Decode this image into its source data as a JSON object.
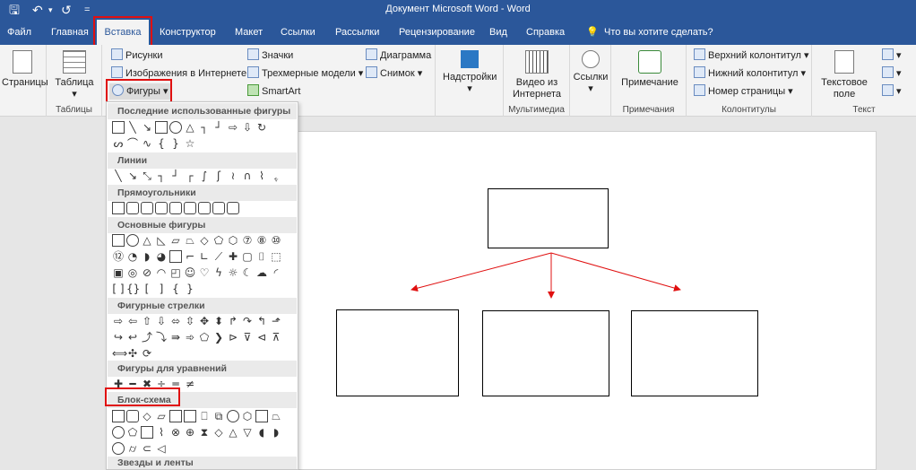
{
  "title": "Документ Microsoft Word  -  Word",
  "qat": {
    "save": "🖫",
    "undo": "↶",
    "redo": "↺",
    "more": "="
  },
  "tabs": [
    "Файл",
    "Главная",
    "Вставка",
    "Конструктор",
    "Макет",
    "Ссылки",
    "Рассылки",
    "Рецензирование",
    "Вид",
    "Справка",
    "Что вы хотите сделать?"
  ],
  "active_tab": "Вставка",
  "ribbon": {
    "pages": "Страницы",
    "table": "Таблица",
    "tables_group": "Таблицы",
    "pictures": "Рисунки",
    "online_pictures": "Изображения в Интернете",
    "shapes": "Фигуры",
    "icons": "Значки",
    "models3d": "Трехмерные модели",
    "smartart": "SmartArt",
    "chart": "Диаграмма",
    "screenshot": "Снимок",
    "addins": "Надстройки",
    "video": "Видео из Интернета",
    "media_group": "Мультимедиа",
    "links": "Ссылки",
    "comment": "Примечание",
    "comments_group": "Примечания",
    "header": "Верхний колонтитул",
    "footer": "Нижний колонтитул",
    "page_number": "Номер страницы",
    "hf_group": "Колонтитулы",
    "textbox": "Текстовое поле",
    "text_group": "Текст"
  },
  "shapes_menu": {
    "categories": [
      "Последние использованные фигуры",
      "Линии",
      "Прямоугольники",
      "Основные фигуры",
      "Фигурные стрелки",
      "Фигуры для уравнений",
      "Блок-схема",
      "Звезды и ленты"
    ]
  },
  "colors": {
    "brand": "#2b579a",
    "highlight": "#e01010",
    "arrow": "#e01010"
  }
}
